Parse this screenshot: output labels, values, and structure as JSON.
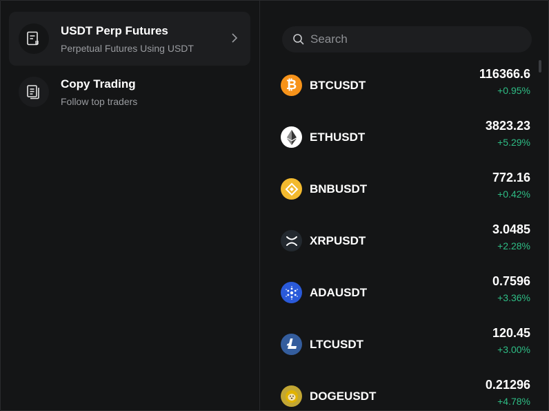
{
  "menu": {
    "items": [
      {
        "title": "USDT Perp Futures",
        "subtitle": "Perpetual Futures Using USDT",
        "icon": "futures-doc-icon",
        "active": true
      },
      {
        "title": "Copy Trading",
        "subtitle": "Follow top traders",
        "icon": "copy-doc-icon",
        "active": false
      }
    ]
  },
  "search": {
    "placeholder": "Search"
  },
  "markets": [
    {
      "symbol": "BTCUSDT",
      "price": "116366.6",
      "change": "+0.95%",
      "icon": "bitcoin-icon",
      "color": "#f7931a"
    },
    {
      "symbol": "ETHUSDT",
      "price": "3823.23",
      "change": "+5.29%",
      "icon": "ethereum-icon",
      "color": "#ffffff"
    },
    {
      "symbol": "BNBUSDT",
      "price": "772.16",
      "change": "+0.42%",
      "icon": "bnb-icon",
      "color": "#f3ba2f"
    },
    {
      "symbol": "XRPUSDT",
      "price": "3.0485",
      "change": "+2.28%",
      "icon": "xrp-icon",
      "color": "#23292f"
    },
    {
      "symbol": "ADAUSDT",
      "price": "0.7596",
      "change": "+3.36%",
      "icon": "cardano-icon",
      "color": "#2a5ada"
    },
    {
      "symbol": "LTCUSDT",
      "price": "120.45",
      "change": "+3.00%",
      "icon": "litecoin-icon",
      "color": "#345d9d"
    },
    {
      "symbol": "DOGEUSDT",
      "price": "0.21296",
      "change": "+4.78%",
      "icon": "dogecoin-icon",
      "color": "#c2a633"
    }
  ],
  "colors": {
    "positive": "#2ebd85",
    "background": "#141516"
  }
}
